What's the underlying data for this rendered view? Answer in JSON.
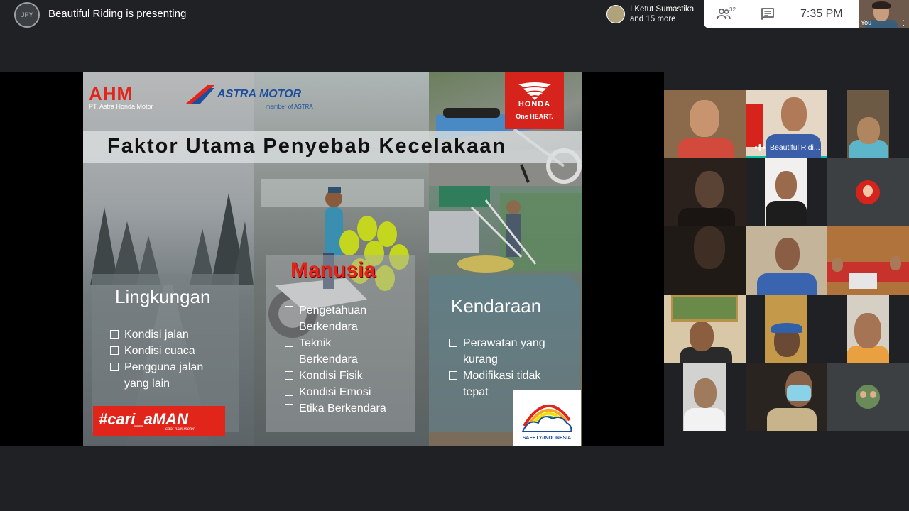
{
  "header": {
    "presenter_initials": "JPY",
    "presenting_text": "Beautiful Riding is presenting"
  },
  "participants_chip": {
    "line1": "I Ketut Sumastika",
    "line2": "and 15 more"
  },
  "controls": {
    "people_count": "32",
    "clock": "7:35 PM",
    "self_label": "You"
  },
  "slide": {
    "logos": {
      "ahm": "AHM",
      "ahm_sub": "PT. Astra Honda Motor",
      "astra": "ASTRA MOTOR",
      "astra_sub": "member of ASTRA",
      "honda": "HONDA",
      "honda_tag": "One HEART."
    },
    "title": "Faktor Utama Penyebab Kecelakaan",
    "sections": [
      {
        "heading": "Lingkungan",
        "items": [
          "Kondisi jalan",
          "Kondisi cuaca",
          "Pengguna jalan yang lain"
        ]
      },
      {
        "heading": "Manusia",
        "items": [
          "Pengetahuan Berkendara",
          "Teknik Berkendara",
          "Kondisi Fisik",
          "Kondisi Emosi",
          "Etika Berkendara"
        ]
      },
      {
        "heading": "Kendaraan",
        "items": [
          "Perawatan yang kurang",
          "Modifikasi tidak tepat"
        ]
      }
    ],
    "campaign": {
      "text": "#cari_aMAN",
      "sub": "saat naik motor"
    },
    "safety_logo_text": "SAFETY-INDONESIA"
  },
  "grid": {
    "active_label": "Beautiful Ridi..."
  },
  "colors": {
    "meet_bg": "#202124",
    "honda_red": "#e1251b",
    "astra_blue": "#1c4e9d",
    "active_speaker": "#00bfa5"
  }
}
